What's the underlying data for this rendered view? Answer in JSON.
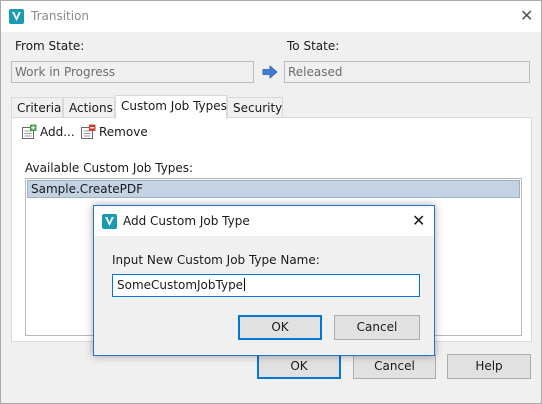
{
  "window": {
    "title": "Transition",
    "icon": "vault-app-icon",
    "close_glyph": "✕"
  },
  "states": {
    "from_label": "From State:",
    "from_value": "Work in Progress",
    "to_label": "To State:",
    "to_value": "Released",
    "arrow_icon": "arrow-right-icon"
  },
  "tabs": [
    {
      "label": "Criteria",
      "active": false
    },
    {
      "label": "Actions",
      "active": false
    },
    {
      "label": "Custom Job Types",
      "active": true
    },
    {
      "label": "Security",
      "active": false
    }
  ],
  "panel": {
    "add_label": "Add...",
    "remove_label": "Remove",
    "list_label": "Available Custom Job Types:",
    "items": [
      "Sample.CreatePDF"
    ]
  },
  "footer": {
    "ok_label": "OK",
    "cancel_label": "Cancel",
    "help_label": "Help"
  },
  "dialog": {
    "title": "Add Custom Job Type",
    "close_glyph": "✕",
    "prompt": "Input New Custom Job Type Name:",
    "input_value": "SomeCustomJobType",
    "ok_label": "OK",
    "cancel_label": "Cancel"
  },
  "colors": {
    "accent": "#0078d7",
    "selection": "#c4d3e3",
    "app_icon": "#1a9bb3"
  }
}
